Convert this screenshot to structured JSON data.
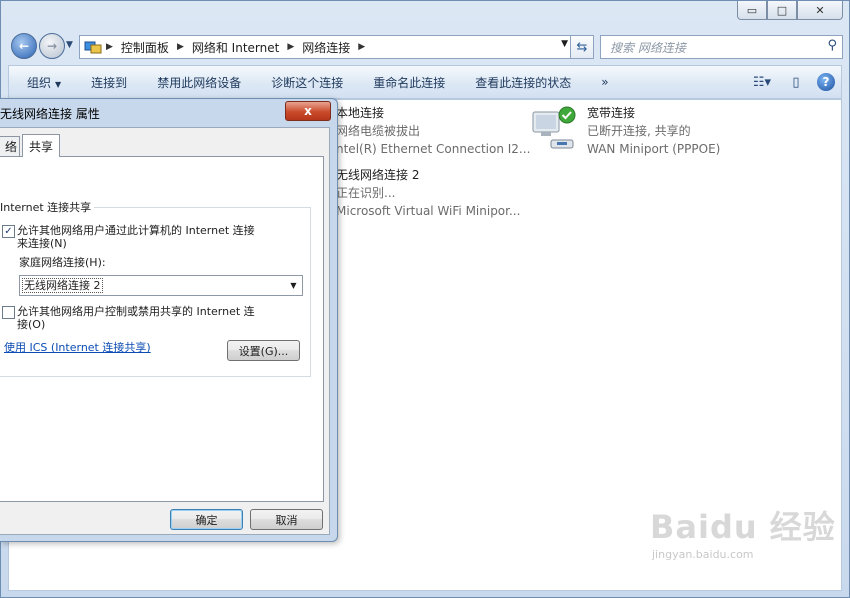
{
  "window": {
    "controls": {
      "minimize": "▭",
      "maximize": "□",
      "close": "✕"
    }
  },
  "address": {
    "crumbs": [
      "控制面板",
      "网络和 Internet",
      "网络连接"
    ],
    "search_placeholder": "搜索 网络连接"
  },
  "toolbar": {
    "items": [
      "组织",
      "连接到",
      "禁用此网络设备",
      "诊断这个连接",
      "重命名此连接",
      "查看此连接的状态"
    ],
    "more": "»"
  },
  "connections": [
    {
      "name": "本地连接",
      "status": "网络电缆被拔出",
      "device": "ntel(R) Ethernet Connection I2..."
    },
    {
      "name": "宽带连接",
      "status": "已断开连接, 共享的",
      "device": "WAN Miniport (PPPOE)"
    },
    {
      "name": "无线网络连接 2",
      "status": "正在识别...",
      "device": "Microsoft Virtual WiFi Minipor..."
    }
  ],
  "dialog": {
    "title": "无线网络连接  属性",
    "close": "x",
    "tabs": [
      "络",
      "共享"
    ],
    "group_label": "Internet 连接共享",
    "allow_share": {
      "line1": "允许其他网络用户通过此计算机的 Internet 连接",
      "line2": "来连接(N)",
      "checked": true
    },
    "home_label": "家庭网络连接(H):",
    "home_value": "无线网络连接 2",
    "allow_control": {
      "line1": "允许其他网络用户控制或禁用共享的 Internet 连",
      "line2": "接(O)",
      "checked": false
    },
    "ics_link": "使用 ICS (Internet 连接共享)",
    "settings": "设置(G)...",
    "ok": "确定",
    "cancel": "取消"
  },
  "watermark": {
    "brand": "Baidu 经验",
    "url": "jingyan.baidu.com"
  }
}
